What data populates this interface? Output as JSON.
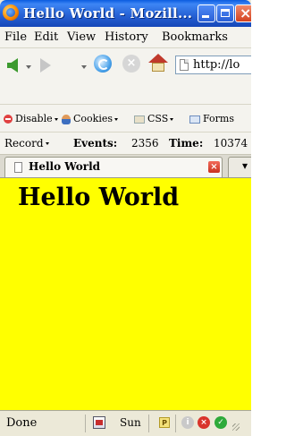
{
  "window": {
    "title": "Hello World - Mozill..."
  },
  "menubar": {
    "items": [
      "File",
      "Edit",
      "View",
      "History",
      "Bookmarks"
    ]
  },
  "navbar": {
    "url": "http://lo"
  },
  "devtoolbar": {
    "items": [
      "Disable",
      "Cookies",
      "CSS",
      "Forms"
    ]
  },
  "recordbar": {
    "record_label": "Record",
    "events_label": "Events:",
    "events_value": "2356",
    "time_label": "Time:",
    "time_value": "10374"
  },
  "tabs": {
    "items": [
      {
        "label": "Hello World",
        "active": true
      }
    ]
  },
  "page": {
    "heading": "Hello World",
    "background": "#ffff00"
  },
  "statusbar": {
    "status": "Done",
    "java_label": "Sun"
  }
}
